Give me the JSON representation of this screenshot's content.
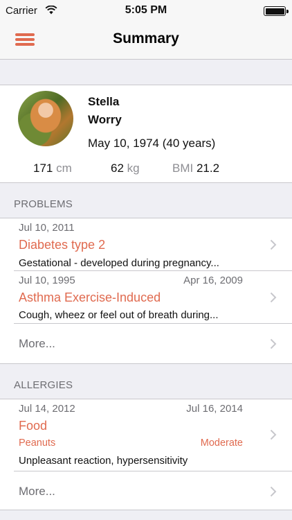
{
  "status_bar": {
    "carrier": "Carrier",
    "time": "5:05 PM",
    "wifi_icon": "wifi-icon",
    "battery_icon": "battery-icon"
  },
  "nav": {
    "title": "Summary",
    "menu_icon": "hamburger-menu-icon",
    "accent_color": "#e06a4f"
  },
  "profile": {
    "first_name": "Stella",
    "last_name": "Worry",
    "birth_date": "May 10, 1974 (40 years)",
    "height_value": "171",
    "height_unit": "cm",
    "weight_value": "62",
    "weight_unit": "kg",
    "bmi_label": "BMI",
    "bmi_value": "21.2"
  },
  "problems": {
    "header": "PROBLEMS",
    "items": [
      {
        "start_date": "Jul 10, 2011",
        "end_date": "",
        "title": "Diabetes type 2",
        "description": "Gestational - developed during pregnancy..."
      },
      {
        "start_date": "Jul 10, 1995",
        "end_date": "Apr 16, 2009",
        "title": "Asthma Exercise-Induced",
        "description": "Cough, wheez or feel out of breath during..."
      }
    ],
    "more_label": "More..."
  },
  "allergies": {
    "header": "ALLERGIES",
    "items": [
      {
        "start_date": "Jul 14, 2012",
        "end_date": "Jul 16, 2014",
        "title": "Food",
        "allergen": "Peanuts",
        "severity": "Moderate",
        "description": "Unpleasant reaction, hypersensitivity"
      }
    ],
    "more_label": "More..."
  }
}
